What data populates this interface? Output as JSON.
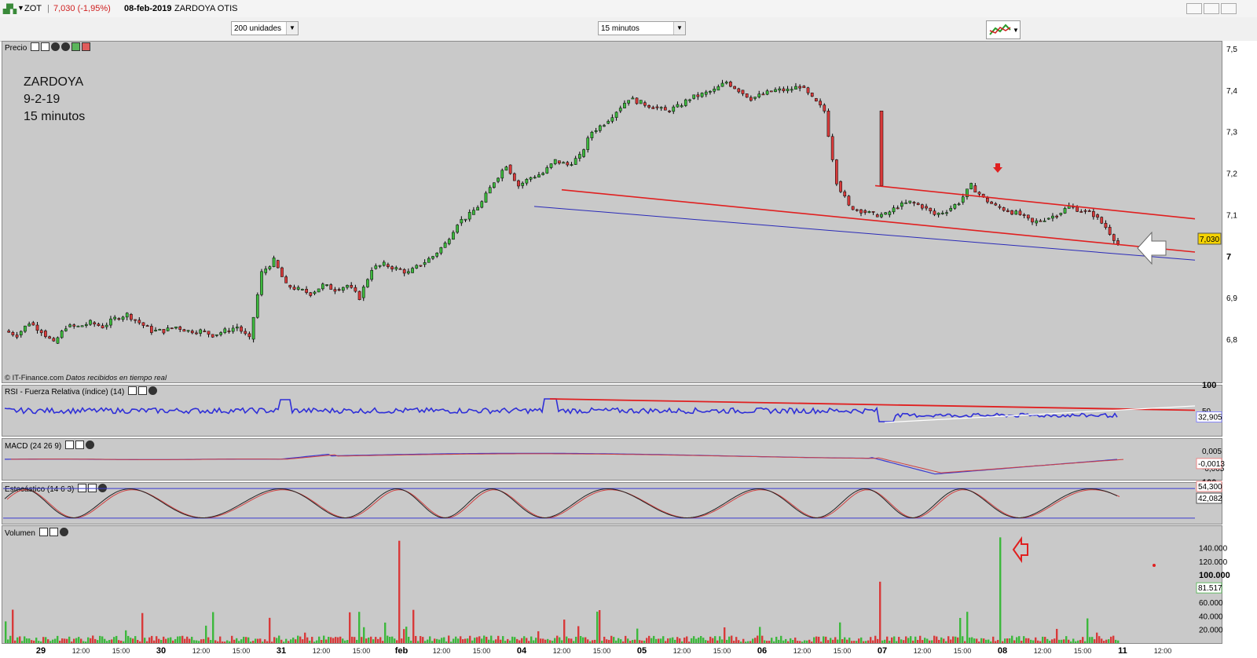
{
  "window": {
    "symbol": "ZOT",
    "last_change": "7,030 (-1,95%)",
    "date": "08-feb-2019",
    "name": "ZARDOYA OTIS"
  },
  "toolbar": {
    "units_select": "200 unidades",
    "interval_select": "15 minutos"
  },
  "annotation": {
    "line1": "ZARDOYA",
    "line2": "9-2-19",
    "line3": "15 minutos"
  },
  "panels": {
    "price": {
      "title": "Precio"
    },
    "rsi": {
      "title": "RSI - Fuerza Relativa (índice) (14)",
      "value_label": "32,905"
    },
    "macd": {
      "title": "MACD (24 26 9)",
      "value_label": "-0,0013"
    },
    "stoch": {
      "title": "Estocástico (14 6 3)",
      "value_label_1": "54,300",
      "value_label_2": "42,082"
    },
    "volume": {
      "title": "Volumen",
      "value_label": "81.517"
    }
  },
  "credit": {
    "source": "© IT-Finance.com",
    "note": "Datos recibidos en tiempo real"
  },
  "price_axis": {
    "ticks": [
      "7,5",
      "7,4",
      "7,3",
      "7,2",
      "7,1",
      "7",
      "6,9",
      "6,8"
    ],
    "bold_tick": "7",
    "last_price_label": "7,030"
  },
  "rsi_axis": {
    "ticks": [
      "100",
      "50"
    ]
  },
  "macd_axis": {
    "ticks": [
      "0,005",
      "-0,005"
    ]
  },
  "stoch_axis": {
    "ticks": [
      "100"
    ]
  },
  "volume_axis": {
    "ticks": [
      "140.000",
      "120.000",
      "100.000",
      "60.000",
      "40.000",
      "20.000"
    ],
    "bold_tick": "100.000"
  },
  "x_axis": {
    "labels": [
      {
        "t": "29",
        "b": true
      },
      {
        "t": "12:00"
      },
      {
        "t": "15:00"
      },
      {
        "t": "30",
        "b": true
      },
      {
        "t": "12:00"
      },
      {
        "t": "15:00"
      },
      {
        "t": "31",
        "b": true
      },
      {
        "t": "12:00"
      },
      {
        "t": "15:00"
      },
      {
        "t": "feb",
        "b": true
      },
      {
        "t": "12:00"
      },
      {
        "t": "15:00"
      },
      {
        "t": "04",
        "b": true
      },
      {
        "t": "12:00"
      },
      {
        "t": "15:00"
      },
      {
        "t": "05",
        "b": true
      },
      {
        "t": "12:00"
      },
      {
        "t": "15:00"
      },
      {
        "t": "06",
        "b": true
      },
      {
        "t": "12:00"
      },
      {
        "t": "15:00"
      },
      {
        "t": "07",
        "b": true
      },
      {
        "t": "12:00"
      },
      {
        "t": "15:00"
      },
      {
        "t": "08",
        "b": true
      },
      {
        "t": "12:00"
      },
      {
        "t": "15:00"
      },
      {
        "t": "11",
        "b": true
      },
      {
        "t": "12:00"
      }
    ]
  },
  "colors": {
    "up": "#3cb83c",
    "down": "#d83a3a",
    "rsi": "#2f2fd8",
    "trend_red": "#e02020",
    "trend_blue": "#2a2ab8",
    "panel_bg": "#c9c9c9"
  },
  "chart_data": {
    "type": "candlestick",
    "title": "ZARDOYA OTIS",
    "ylabel": "",
    "ylim": [
      6.75,
      7.52
    ],
    "sessions": [
      "29",
      "30",
      "31",
      "feb",
      "04",
      "05",
      "06",
      "07",
      "08",
      "11"
    ],
    "session_close_estimates": [
      6.82,
      6.82,
      6.92,
      6.98,
      7.13,
      7.36,
      7.41,
      7.13,
      7.11,
      7.03
    ],
    "price_path": [
      6.82,
      6.81,
      6.84,
      6.82,
      6.79,
      6.83,
      6.83,
      6.84,
      6.83,
      6.85,
      6.86,
      6.84,
      6.82,
      6.82,
      6.83,
      6.82,
      6.82,
      6.81,
      6.82,
      6.83,
      6.8,
      6.96,
      6.99,
      6.93,
      6.92,
      6.91,
      6.93,
      6.92,
      6.93,
      6.9,
      6.97,
      6.98,
      6.97,
      6.96,
      6.98,
      7.0,
      7.03,
      7.08,
      7.1,
      7.13,
      7.18,
      7.22,
      7.17,
      7.19,
      7.2,
      7.23,
      7.22,
      7.24,
      7.3,
      7.32,
      7.35,
      7.38,
      7.37,
      7.36,
      7.35,
      7.36,
      7.38,
      7.39,
      7.4,
      7.42,
      7.4,
      7.38,
      7.39,
      7.4,
      7.4,
      7.41,
      7.38,
      7.35,
      7.18,
      7.12,
      7.11,
      7.1,
      7.1,
      7.12,
      7.13,
      7.12,
      7.1,
      7.11,
      7.13,
      7.17,
      7.14,
      7.12,
      7.11,
      7.1,
      7.08,
      7.09,
      7.1,
      7.12,
      7.11,
      7.1,
      7.07,
      7.03
    ],
    "trendlines": [
      {
        "color": "red",
        "from": {
          "session": "04",
          "price": 7.16
        },
        "to": {
          "session": "11",
          "price": 7.01
        }
      },
      {
        "color": "blue",
        "from": {
          "session": "04",
          "price": 7.12
        },
        "to": {
          "session": "11",
          "price": 7.0
        }
      },
      {
        "color": "red",
        "from": {
          "session": "07",
          "price": 7.17
        },
        "to": {
          "session": "11",
          "price": 7.09
        }
      }
    ],
    "volume_spikes": [
      {
        "session": "feb",
        "value": 150000
      },
      {
        "session": "07",
        "value": 90000
      },
      {
        "session": "08",
        "value": 155000
      },
      {
        "session": "11",
        "value": 82000
      }
    ],
    "rsi_last": 32.905,
    "macd_last": -0.0013,
    "stoch_last": [
      54.3,
      42.082
    ],
    "volume_last": 81517,
    "grid": false
  }
}
